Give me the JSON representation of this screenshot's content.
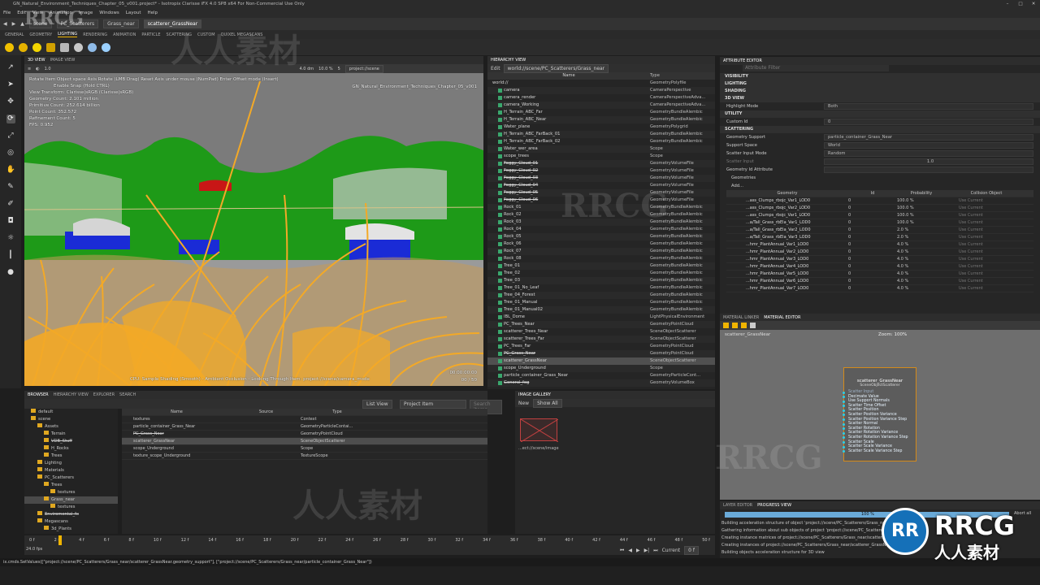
{
  "window": {
    "title": "GN_Natural_Environment_Techniques_Chapter_05_v001.project* - Isotropix Clarisse iFX 4.0 SP8 x64 For Non-Commercial Use Only"
  },
  "menu": [
    "File",
    "Edit",
    "View",
    "Animation",
    "Image",
    "Windows",
    "Layout",
    "Help"
  ],
  "nav": {
    "crumbs": [
      "scene",
      "PC_Scatterers",
      "Grass_near",
      "scatterer_GrassNear"
    ]
  },
  "shelf_tabs": [
    "GENERAL",
    "GEOMETRY",
    "LIGHTING",
    "RENDERING",
    "ANIMATION",
    "PARTICLE",
    "SCATTERING",
    "CUSTOM",
    "QUIXEL MEGASCANS"
  ],
  "viewport": {
    "tabs": [
      "3D VIEW",
      "IMAGE VIEW"
    ],
    "toolbar": {
      "zoom": "1.0",
      "distance": "4.0 dm",
      "percent": "10.0 %",
      "samples": "5",
      "path": "project://scene"
    },
    "overlay_lines": [
      "Rotate Item Object space Axis Rotate (LMB Drag) Reset Axis under mouse (NumPad) Enter Offset mode (Insert)",
      "Enable Snap (Hold CTRL)",
      "View Transform: Clarisse|sRGB (Clarisse|sRGB)",
      "Geometry Count: 2.101 million",
      "Primitive Count: 252.614 billion",
      "Point Count: 352.572",
      "Refinement Count: 5",
      "FPS: 0.952"
    ],
    "overlay_right": "GN_Natural_Environment_Techniques_Chapter_05_v001",
    "footer": "CPU: Sample Shading (Smooth) - Ambient Occlusion - Looking Through Item: project://scene/camera_mode",
    "time": "00:00:00:00",
    "frame": "00 / 50"
  },
  "hierarchy": {
    "title": "HIERARCHY VIEW",
    "path": "world://scene/PC_Scatterers/Grass_near",
    "edit_label": "Edit",
    "col_name": "Name",
    "col_type": "Type",
    "rows": [
      [
        "world://",
        "GeometryPolyfile"
      ],
      [
        "camera",
        "CameraPerspective"
      ],
      [
        "camera_render",
        "CameraPerspectiveAdva..."
      ],
      [
        "camera_Working",
        "CameraPerspectiveAdva..."
      ],
      [
        "H_Terrain_ABC_Far",
        "GeometryBundleAlembic"
      ],
      [
        "H_Terrain_ABC_Near",
        "GeometryBundleAlembic"
      ],
      [
        "Water_plane",
        "GeometryPolygrid"
      ],
      [
        "H_Terrain_ABC_FarBack_01",
        "GeometryBundleAlembic"
      ],
      [
        "H_Terrain_ABC_FarBack_02",
        "GeometryBundleAlembic"
      ],
      [
        "Water_wer_area",
        "Scope"
      ],
      [
        "scope_trees",
        "Scope"
      ],
      [
        "Foggy_Cloud_01",
        "GeometryVolumeFile"
      ],
      [
        "Foggy_Cloud_02",
        "GeometryVolumeFile"
      ],
      [
        "Foggy_Cloud_03",
        "GeometryVolumeFile"
      ],
      [
        "Foggy_Cloud_04",
        "GeometryVolumeFile"
      ],
      [
        "Foggy_Cloud_05",
        "GeometryVolumeFile"
      ],
      [
        "Foggy_Cloud_06",
        "GeometryVolumeFile"
      ],
      [
        "Rock_01",
        "GeometryBundleAlembic"
      ],
      [
        "Rock_02",
        "GeometryBundleAlembic"
      ],
      [
        "Rock_03",
        "GeometryBundleAlembic"
      ],
      [
        "Rock_04",
        "GeometryBundleAlembic"
      ],
      [
        "Rock_05",
        "GeometryBundleAlembic"
      ],
      [
        "Rock_06",
        "GeometryBundleAlembic"
      ],
      [
        "Rock_07",
        "GeometryBundleAlembic"
      ],
      [
        "Rock_08",
        "GeometryBundleAlembic"
      ],
      [
        "Tree_01",
        "GeometryBundleAlembic"
      ],
      [
        "Tree_02",
        "GeometryBundleAlembic"
      ],
      [
        "Tree_03",
        "GeometryBundleAlembic"
      ],
      [
        "Tree_01_No_Leaf",
        "GeometryBundleAlembic"
      ],
      [
        "Tree_04_Forest",
        "GeometryBundleAlembic"
      ],
      [
        "Tree_01_Manual",
        "GeometryBundleAlembic"
      ],
      [
        "Tree_01_Manual02",
        "GeometryBundleAlembic"
      ],
      [
        "IBL_Dome",
        "LightPhysicalEnvironment"
      ],
      [
        "PC_Trees_Near",
        "GeometryPointCloud"
      ],
      [
        "scatterer_Trees_Near",
        "SceneObjectScatterer"
      ],
      [
        "scatterer_Trees_Far",
        "SceneObjectScatterer"
      ],
      [
        "PC_Trees_Far",
        "GeometryPointCloud"
      ],
      [
        "PC_Grass_Near",
        "GeometryPointCloud"
      ],
      [
        "scatterer_GrassNear",
        "SceneObjectScatterer"
      ],
      [
        "scope_Underground",
        "Scope"
      ],
      [
        "particle_container_Grass_Near",
        "GeometryParticleCont..."
      ],
      [
        "General_fog",
        "GeometryVolumeBox"
      ]
    ]
  },
  "attributes": {
    "title": "ATTRIBUTE EDITOR",
    "filter_placeholder": "Attribute Filter",
    "sections": [
      "VISIBILITY",
      "LIGHTING",
      "SHADING",
      "3D VIEW",
      "UTILITY",
      "SCATTERING"
    ],
    "highlight_mode": {
      "label": "Highlight Mode",
      "value": "Both"
    },
    "custom_id": {
      "label": "Custom Id",
      "value": "0"
    },
    "geometry_support": {
      "label": "Geometry Support",
      "value": "particle_container_Grass_Near"
    },
    "support_space": {
      "label": "Support Space",
      "value": "World"
    },
    "scatter_input_mode": {
      "label": "Scatter Input Mode",
      "value": "Random"
    },
    "scatter_input": {
      "label": "Scatter Input",
      "value": "1.0"
    },
    "geometry_id_attr": {
      "label": "Geometry Id Attribute",
      "value": ""
    },
    "geometries_label": "Geometries",
    "add_label": "Add...",
    "table_cols": [
      "Geometry",
      "Id",
      "Probability",
      "Collision Object"
    ],
    "table_rows": [
      [
        "...ass_Clumps_rbojc_Var1_LOD0",
        "0",
        "100.0 %",
        "Use Current"
      ],
      [
        "...ass_Clumps_rbojc_Var2_LOD0",
        "0",
        "100.0 %",
        "Use Current"
      ],
      [
        "...ass_Clumps_rbojc_Var1_LOD0",
        "0",
        "100.0 %",
        "Use Current"
      ],
      [
        "...a/Tall_Grass_rbEla_Var1_LOD0",
        "0",
        "100.0 %",
        "Use Current"
      ],
      [
        "...a/Tall_Grass_rbEla_Var2_LOD0",
        "0",
        "2.0 %",
        "Use Current"
      ],
      [
        "...a/Tall_Grass_rbEla_Var3_LOD0",
        "0",
        "2.0 %",
        "Use Current"
      ],
      [
        "...hmr_PlantAnnual_Var1_LOD0",
        "0",
        "4.0 %",
        "Use Current"
      ],
      [
        "...hmr_PlantAnnual_Var2_LOD0",
        "0",
        "4.0 %",
        "Use Current"
      ],
      [
        "...hmr_PlantAnnual_Var3_LOD0",
        "0",
        "4.0 %",
        "Use Current"
      ],
      [
        "...hmr_PlantAnnual_Var4_LOD0",
        "0",
        "4.0 %",
        "Use Current"
      ],
      [
        "...hmr_PlantAnnual_Var5_LOD0",
        "0",
        "4.0 %",
        "Use Current"
      ],
      [
        "...hmr_PlantAnnual_Var6_LOD0",
        "0",
        "4.0 %",
        "Use Current"
      ],
      [
        "...hmr_PlantAnnual_Var7_LOD0",
        "0",
        "4.0 %",
        "Use Current"
      ]
    ]
  },
  "material": {
    "tabs": [
      "MATERIAL LINKER",
      "MATERIAL EDITOR"
    ],
    "path": "scatterer_GrassNear",
    "zoom": "Zoom: 100%",
    "node_title": "scatterer_GrassNear",
    "node_subtitle": "SceneObjectScatterer",
    "ports": [
      "Scatter Input",
      "Decimate Value",
      "Use Support Normals",
      "Scatter Time Offset",
      "Scatter Position",
      "Scatter Position Variance",
      "Scatter Position Variance Step",
      "Scatter Normal",
      "Scatter Rotation",
      "Scatter Rotation Variance",
      "Scatter Rotation Variance Step",
      "Scatter Scale",
      "Scatter Scale Variance",
      "Scatter Scale Variance Step"
    ]
  },
  "browser": {
    "tabs": [
      "BROWSER",
      "HIERARCHY VIEW",
      "EXPLORER",
      "SEARCH"
    ],
    "view_mode": "List View",
    "filter": "Project Item",
    "search_placeholder": "Search items",
    "tree": [
      "default",
      "scene",
      "Assets",
      "Terrain",
      "VDB_Stuff",
      "H_Rocks",
      "Trees",
      "Lighting",
      "Materials",
      "PC_Scatterers",
      "Trees",
      "textures",
      "Grass_near",
      "textures",
      "Enviromental_fx",
      "Megascans",
      "3d_Plants"
    ],
    "cols": [
      "Name",
      "Source",
      "Type"
    ],
    "items": [
      [
        "textures",
        "",
        "Context"
      ],
      [
        "particle_container_Grass_Near",
        "",
        "GeometryParticleContai..."
      ],
      [
        "PC_Grass_Near",
        "",
        "GeometryPointCloud"
      ],
      [
        "scatterer_GrassNear",
        "",
        "SceneObjectScatterer"
      ],
      [
        "scope_Underground",
        "",
        "Scope"
      ],
      [
        "texture_scope_Underground",
        "",
        "TextureScope"
      ]
    ]
  },
  "gallery": {
    "title": "IMAGE GALLERY",
    "new_label": "New",
    "show_all": "Show All",
    "image_path": "...ect://scene/image"
  },
  "progress": {
    "tabs": [
      "LAYER EDITOR",
      "PROGRESS VIEW"
    ],
    "percent": "100 %",
    "fraction": 1.0,
    "abort": "Abort all",
    "lines": [
      "Building acceleration structure of object 'project://scene/PC_Scatterers/Grass_near/sc...",
      "Gathering information about sub objects of project 'project://scene/PC_Scatterers/Grass_near/...",
      "Creating instance matrices of project://scene/PC_Scatterers/Grass_near/scatterer_GrassNear",
      "Creating instances of project://scene/PC_Scatterers/Grass_near/scatterer_GrassNear...",
      "Building objects acceleration structure for 3D view"
    ]
  },
  "timeline": {
    "ticks": [
      "0 f",
      "2 f",
      "4 f",
      "6 f",
      "8 f",
      "10 f",
      "12 f",
      "14 f",
      "16 f",
      "18 f",
      "20 f",
      "22 f",
      "24 f",
      "26 f",
      "28 f",
      "30 f",
      "32 f",
      "34 f",
      "36 f",
      "38 f",
      "40 f",
      "42 f",
      "44 f",
      "46 f",
      "48 f",
      "50 f"
    ],
    "fps": "24.0 fps",
    "start": "0 f",
    "end": "0 f",
    "current": "Current",
    "current_value": "0 f"
  },
  "command": "ix.cmds.SetValues([\"project://scene/PC_Scatterers/Grass_near/scatterer_GrassNear.geometry_support\"], [\"project://scene/PC_Scatterers/Grass_near/particle_container_Grass_Near\"])",
  "watermarks": {
    "brand": "RRCG",
    "cn": "人人素材",
    "logo_letters": "RR"
  },
  "colors": {
    "grass": "#f3a927",
    "foliage": "#1e9a18",
    "rock": "#1a2bd6",
    "accent": "#f0b400",
    "sky": "#7d7d7d"
  }
}
